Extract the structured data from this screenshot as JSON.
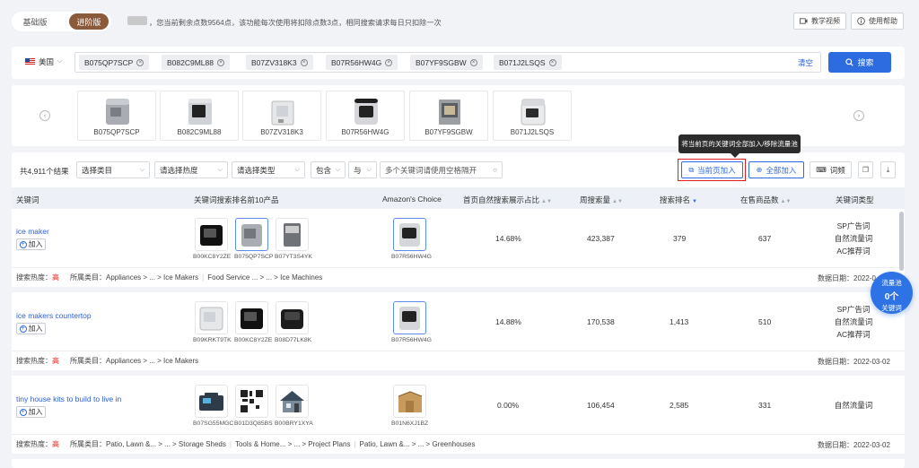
{
  "version_toggle": {
    "basic": "基础版",
    "advanced": "进阶版"
  },
  "notice": "，您当前剩余点数9564点，该功能每次使用将扣除点数3点，相同搜索请求每日只扣除一次",
  "top_buttons": {
    "tutorial": "教学视频",
    "help": "使用帮助"
  },
  "search": {
    "country": "美国",
    "chips": [
      "B075QP7SCP",
      "B082C9ML88",
      "B07ZV318K3",
      "B07R56HW4G",
      "B07YF9SGBW",
      "B071J2LSQS"
    ],
    "clear": "清空",
    "button": "搜索"
  },
  "products": [
    "B075QP7SCP",
    "B082C9ML88",
    "B07ZV318K3",
    "B07R56HW4G",
    "B07YF9SGBW",
    "B071J2LSQS"
  ],
  "toolbar": {
    "result_count": "共4,911个结果",
    "category_placeholder": "选择类目",
    "heat_placeholder": "请选择热度",
    "type_placeholder": "请选择类型",
    "include": "包含",
    "logic": "与",
    "keyword_placeholder": "多个关键词请使用空格隔开",
    "add_current": "当前页加入",
    "add_all": "全部加入",
    "roots": "词频",
    "tooltip": "将当前页的关键词全部加入/移除流量池"
  },
  "table": {
    "headers": [
      "关键词",
      "关键词搜索排名前10产品",
      "Amazon's Choice",
      "首页自然搜索展示占比",
      "周搜索量",
      "搜索排名",
      "在售商品数",
      "关键词类型"
    ],
    "add_label": "加入",
    "heat_label": "搜索热度：",
    "category_label": "所属类目：",
    "date_label": "数据日期：",
    "rows": [
      {
        "keyword": "ice maker",
        "top_asins": [
          "B00KC8Y2ZE",
          "B075QP7SCP",
          "B07YT3S4YK"
        ],
        "choice_asin": "B07R56HW4G",
        "share": "14.68%",
        "weekly": "423,387",
        "rank": "379",
        "listings": "637",
        "types": [
          "SP广告词",
          "自然流量词",
          "AC推荐词"
        ],
        "heat": "高",
        "categories": [
          "Appliances > ... > Ice Makers",
          "Food Service ... > ... > Ice Machines"
        ],
        "date": "2022-0"
      },
      {
        "keyword": "ice makers countertop",
        "top_asins": [
          "B09KRKT9TK",
          "B00KC8Y2ZE",
          "B08D77LK8K"
        ],
        "choice_asin": "B07R56HW4G",
        "share": "14.88%",
        "weekly": "170,538",
        "rank": "1,413",
        "listings": "510",
        "types": [
          "SP广告词",
          "自然流量词",
          "AC推荐词"
        ],
        "heat": "高",
        "categories": [
          "Appliances > ... > Ice Makers"
        ],
        "date": "2022-03-02"
      },
      {
        "keyword": "tiny house kits to build to live in",
        "top_asins": [
          "B07SG55MGC",
          "B01D3Q85BS",
          "B00BRY1XYA"
        ],
        "choice_asin": "B01N6XJ1BZ",
        "share": "0.00%",
        "weekly": "106,454",
        "rank": "2,585",
        "listings": "331",
        "types": [
          "自然流量词"
        ],
        "heat": "高",
        "categories": [
          "Patio, Lawn &... > ... > Storage Sheds",
          "Tools & Home... > ... > Project Plans",
          "Patio, Lawn &... > ... > Greenhouses"
        ],
        "date": "2022-03-02"
      }
    ]
  },
  "pool": {
    "title": "流量池",
    "count": "0个",
    "sub": "关键词"
  }
}
